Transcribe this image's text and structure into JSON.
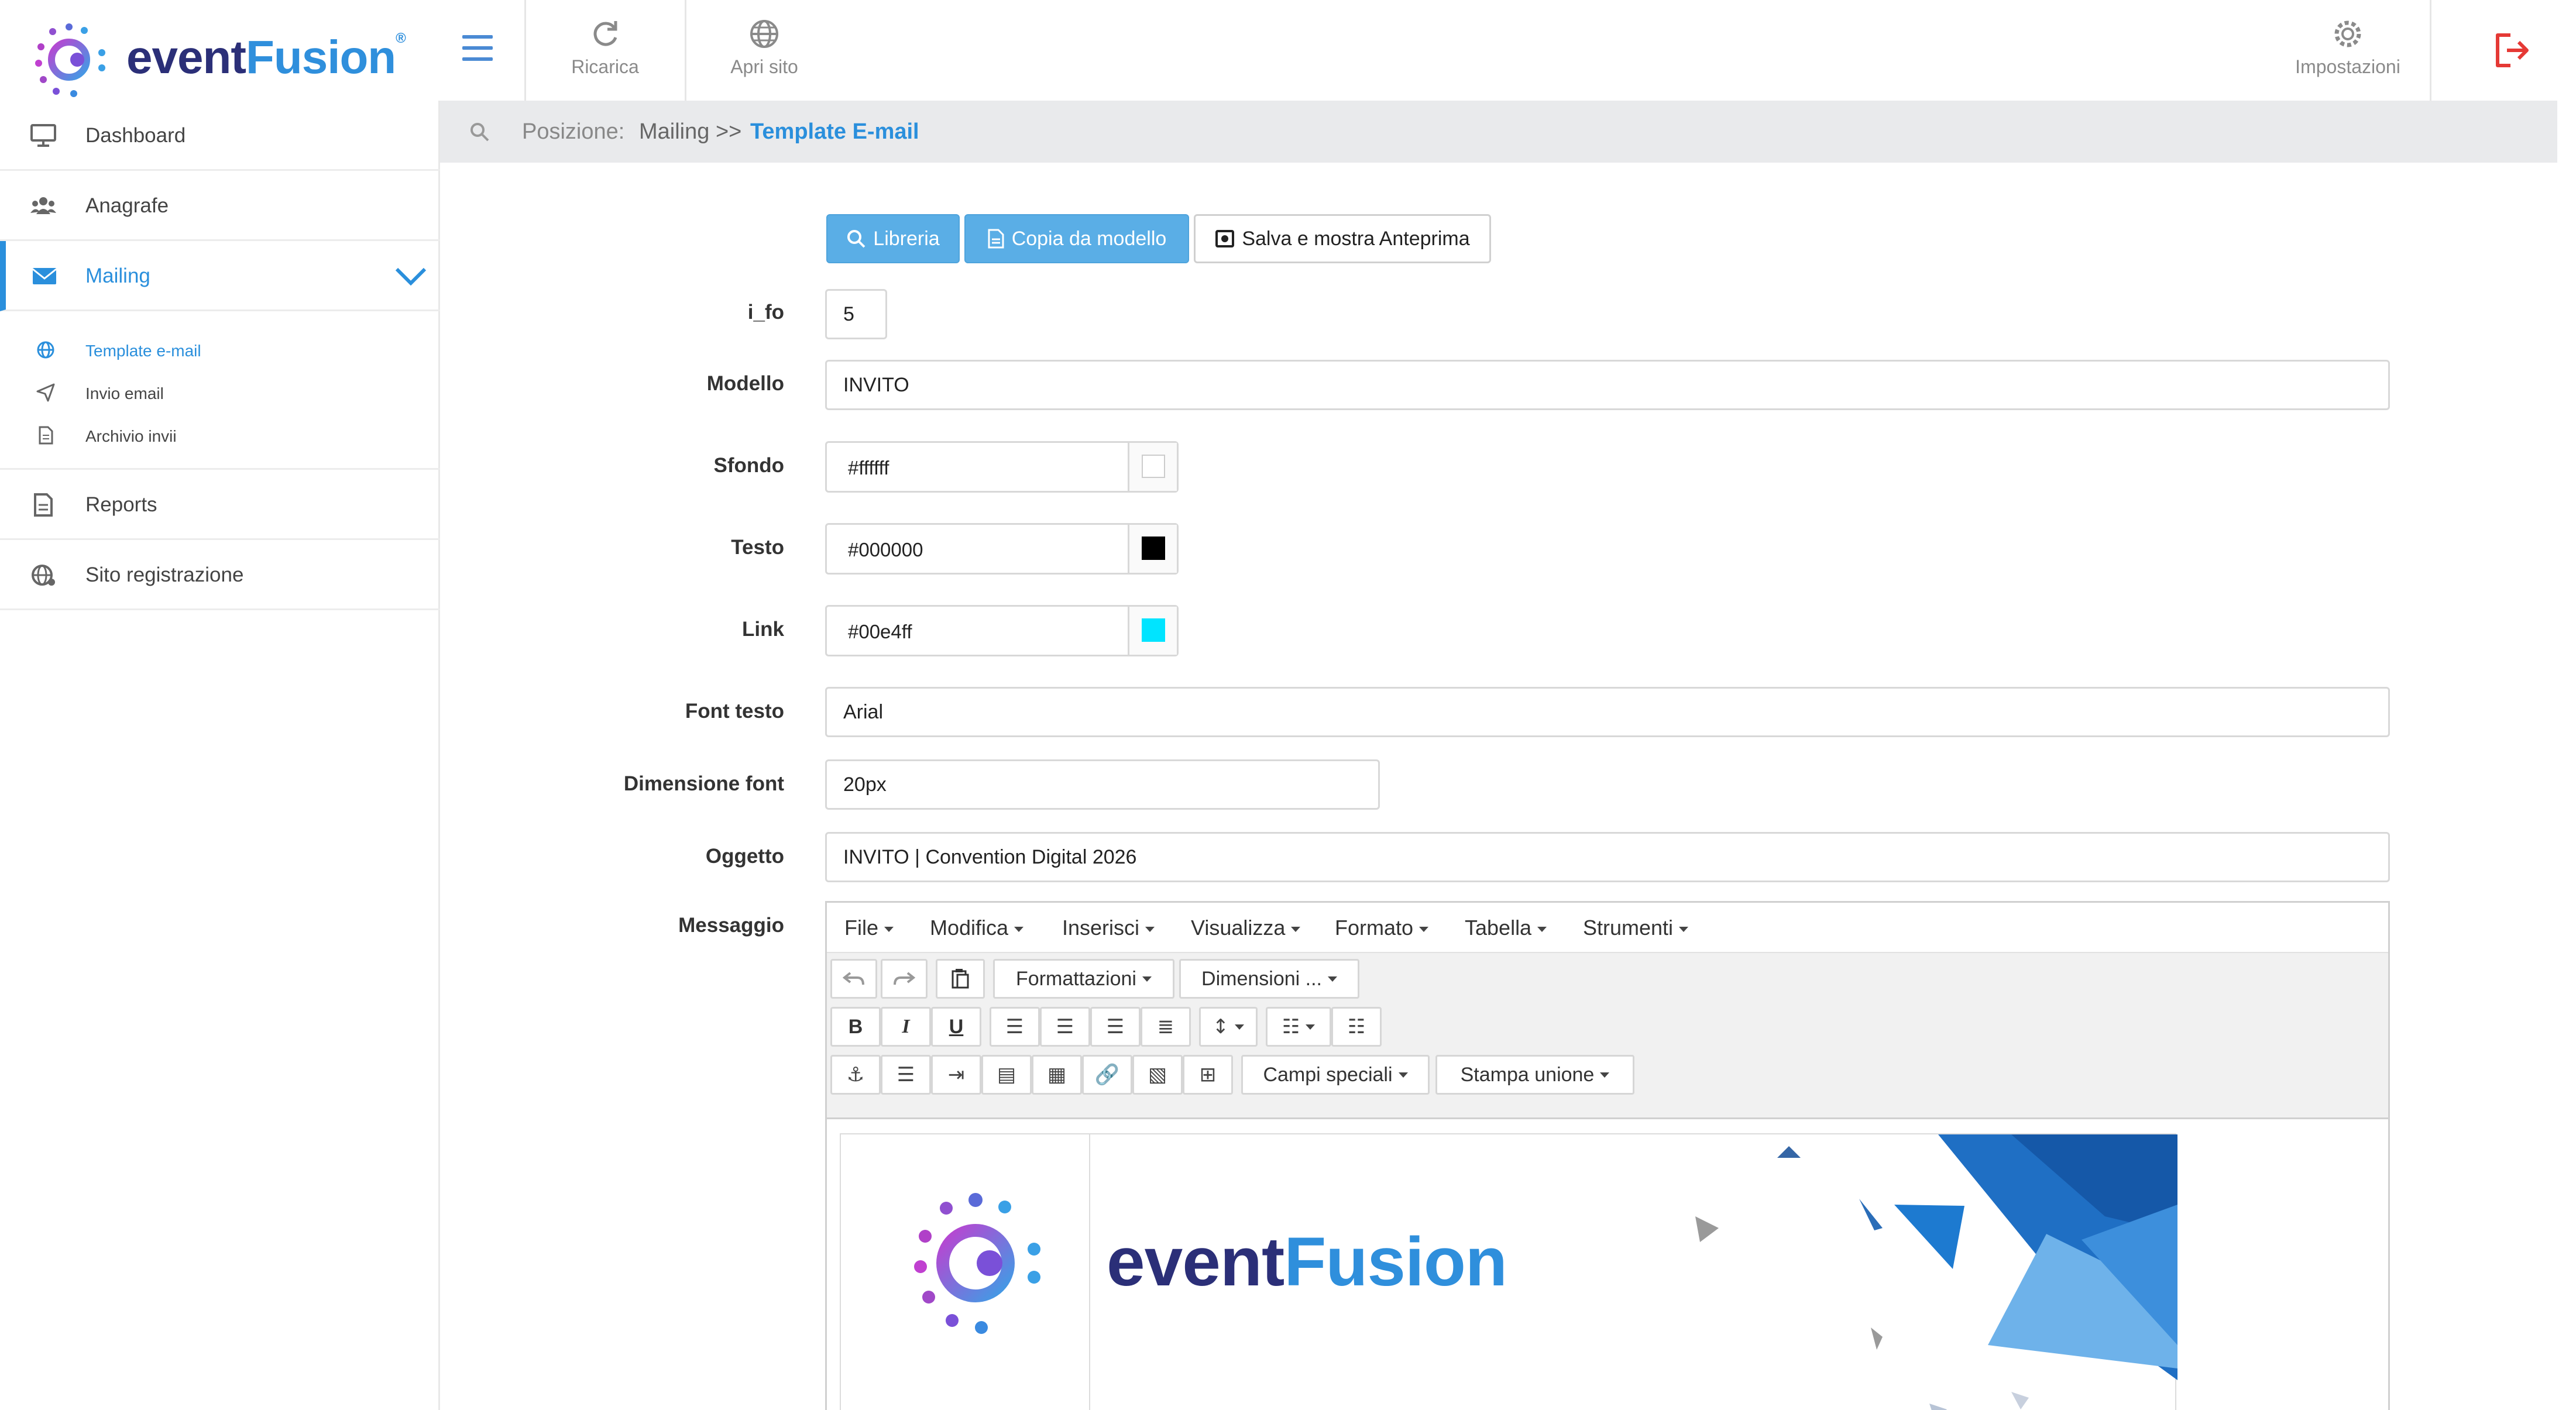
{
  "app": {
    "name_part1": "event",
    "name_part2": "Fusion",
    "name_mark": "®"
  },
  "toolbar": {
    "reload_label": "Ricarica",
    "open_site_label": "Apri sito",
    "settings_label": "Impostazioni"
  },
  "breadcrumb": {
    "label": "Posizione:",
    "path": "Mailing >>",
    "current": "Template E-mail"
  },
  "sidebar": {
    "items": [
      {
        "label": "Dashboard",
        "icon": "monitor-icon"
      },
      {
        "label": "Anagrafe",
        "icon": "users-icon"
      },
      {
        "label": "Mailing",
        "icon": "envelope-icon",
        "active": true
      },
      {
        "label": "Reports",
        "icon": "document-icon"
      },
      {
        "label": "Sito registrazione",
        "icon": "globe-icon"
      }
    ],
    "subitems": [
      {
        "label": "Template e-mail",
        "icon": "globe-icon",
        "active": true
      },
      {
        "label": "Invio email",
        "icon": "send-icon"
      },
      {
        "label": "Archivio invii",
        "icon": "document-icon"
      }
    ]
  },
  "actions": {
    "library": "Libreria",
    "copy_model": "Copia da modello",
    "save_preview": "Salva e mostra Anteprima"
  },
  "form": {
    "id_label": "i_fo",
    "id_value": "5",
    "model_label": "Modello",
    "model_value": "INVITO",
    "background_label": "Sfondo",
    "background_value": "#ffffff",
    "text_label": "Testo",
    "text_value": "#000000",
    "link_label": "Link",
    "link_value": "#00e4ff",
    "font_label": "Font testo",
    "font_value": "Arial",
    "font_size_label": "Dimensione font",
    "font_size_value": "20px",
    "subject_label": "Oggetto",
    "subject_value": "INVITO | Convention Digital 2026",
    "message_label": "Messaggio"
  },
  "editor": {
    "menus": [
      "File",
      "Modifica",
      "Inserisci",
      "Visualizza",
      "Formato",
      "Tabella",
      "Strumenti"
    ],
    "formats_label": "Formattazioni",
    "sizes_label": "Dimensioni ...",
    "special_fields_label": "Campi speciali",
    "mail_merge_label": "Stampa unione",
    "bold": "B",
    "italic": "I",
    "underline": "U"
  },
  "banner": {
    "part1": "event",
    "part2": "Fusion"
  },
  "colors": {
    "accent": "#2a8fdc",
    "button_blue": "#5aaee6",
    "logout_red": "#e53935",
    "swatch_background": "#ffffff",
    "swatch_text": "#000000",
    "swatch_link": "#00e4ff"
  }
}
